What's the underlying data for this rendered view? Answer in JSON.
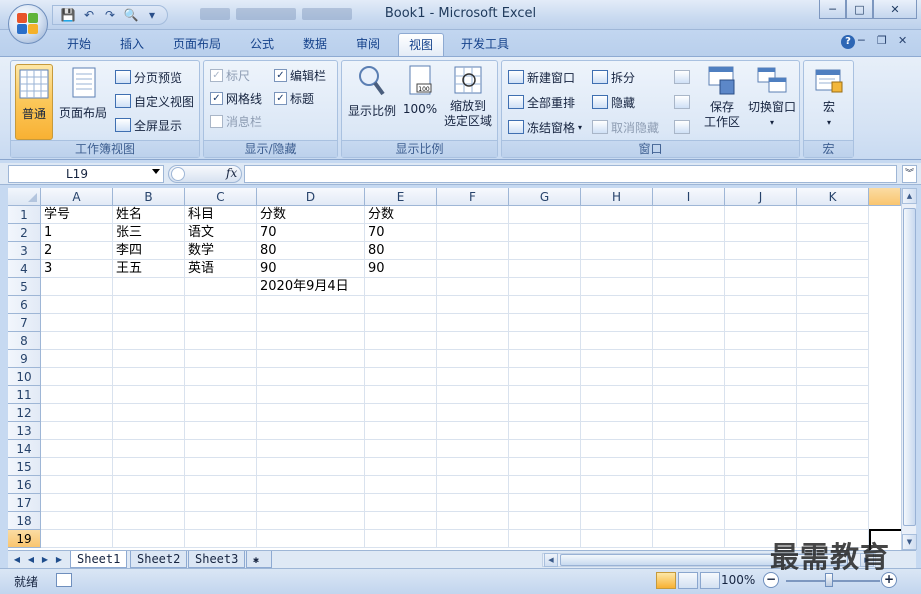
{
  "window": {
    "title": "Book1 - Microsoft Excel",
    "minimize": "─",
    "maximize": "□",
    "close": "✕"
  },
  "qat": {
    "save": "💾",
    "undo": "↶",
    "redo": "↷",
    "preview": "🔍",
    "more": "▾"
  },
  "tabs": [
    {
      "label": "开始"
    },
    {
      "label": "插入"
    },
    {
      "label": "页面布局"
    },
    {
      "label": "公式"
    },
    {
      "label": "数据"
    },
    {
      "label": "审阅"
    },
    {
      "label": "视图",
      "active": true
    },
    {
      "label": "开发工具"
    }
  ],
  "ribbon": {
    "help": "?",
    "minimize": "─",
    "restore": "❐",
    "close": "✕",
    "groups": {
      "workbook_views": {
        "label": "工作簿视图",
        "normal": "普通",
        "page_layout": "页面布局",
        "page_break": "分页预览",
        "custom_views": "自定义视图",
        "full_screen": "全屏显示"
      },
      "show_hide": {
        "label": "显示/隐藏",
        "ruler": "标尺",
        "formula_bar": "编辑栏",
        "gridlines": "网格线",
        "headings": "标题",
        "message_bar": "消息栏"
      },
      "zoom": {
        "label": "显示比例",
        "zoom": "显示比例",
        "hundred": "100%",
        "zoom_to_sel_1": "缩放到",
        "zoom_to_sel_2": "选定区域"
      },
      "window": {
        "label": "窗口",
        "new_window": "新建窗口",
        "arrange_all": "全部重排",
        "freeze_panes": "冻结窗格",
        "split": "拆分",
        "hide": "隐藏",
        "unhide": "取消隐藏",
        "save_ws_1": "保存",
        "save_ws_2": "工作区",
        "switch_1": "切换窗口"
      },
      "macro": {
        "label": "宏",
        "macro": "宏"
      }
    }
  },
  "formula_bar": {
    "name_box": "L19",
    "fx": "fx",
    "value": ""
  },
  "grid": {
    "columns": [
      "A",
      "B",
      "C",
      "D",
      "E",
      "F",
      "G",
      "H",
      "I",
      "J",
      "K"
    ],
    "rows": [
      "1",
      "2",
      "3",
      "4",
      "5",
      "6",
      "7",
      "8",
      "9",
      "10",
      "11",
      "12",
      "13",
      "14",
      "15",
      "16",
      "17",
      "18",
      "19"
    ],
    "selected_row": "19",
    "cells": [
      [
        "学号",
        "姓名",
        "科目",
        "分数",
        "分数"
      ],
      [
        "1",
        "张三",
        "语文",
        "70",
        "70"
      ],
      [
        "2",
        "李四",
        "数学",
        "80",
        "80"
      ],
      [
        "3",
        "王五",
        "英语",
        "90",
        "90"
      ],
      [
        "",
        "",
        "",
        "2020年9月4日",
        ""
      ]
    ]
  },
  "sheets": [
    {
      "label": "Sheet1",
      "active": true
    },
    {
      "label": "Sheet2"
    },
    {
      "label": "Sheet3"
    }
  ],
  "status": {
    "ready": "就绪",
    "zoom": "100%",
    "minus": "−",
    "plus": "+"
  },
  "watermark": "最需教育"
}
